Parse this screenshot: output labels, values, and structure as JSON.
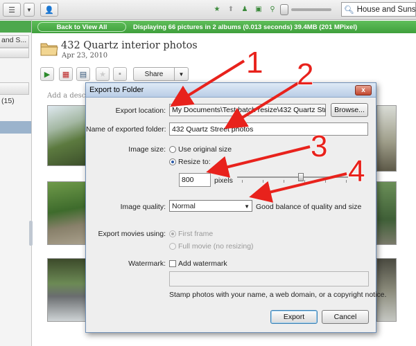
{
  "search": {
    "value": "House and Sunsets"
  },
  "status_bar": {
    "back_label": "Back to View All",
    "status": "Displaying 66 pictures in 2 albums (0.013 seconds) 39.4MB (201 MPixel)"
  },
  "left_panel": {
    "item1": "and S...",
    "count": "(15)"
  },
  "album": {
    "title": "432 Quartz interior photos",
    "date": "Apr 23, 2010",
    "description_hint": "Add a descri",
    "share_label": "Share"
  },
  "dialog": {
    "title": "Export to Folder",
    "close_label": "x",
    "export_location_label": "Export location:",
    "export_location_value": "My Documents\\Test batch resize\\432 Quartz Str",
    "browse_label": "Browse...",
    "folder_name_label": "Name of exported folder:",
    "folder_name_value": "432 Quartz Street photos",
    "image_size_label": "Image size:",
    "use_original_label": "Use original size",
    "resize_to_label": "Resize to:",
    "resize_value": "800",
    "pixels_label": "pixels",
    "image_quality_label": "Image quality:",
    "quality_value": "Normal",
    "quality_hint": "Good balance of quality and size",
    "export_movies_label": "Export movies using:",
    "first_frame_label": "First frame",
    "full_movie_label": "Full movie (no resizing)",
    "watermark_label": "Watermark:",
    "add_watermark_label": "Add watermark",
    "watermark_hint": "Stamp photos with your name, a web domain, or a copyright notice.",
    "export_label": "Export",
    "cancel_label": "Cancel"
  },
  "annotations": [
    "1",
    "2",
    "3",
    "4"
  ],
  "colors": {
    "arrow": "#e8221c",
    "status_green": "#4da84d",
    "dialog_title": "#c9d9ee"
  }
}
